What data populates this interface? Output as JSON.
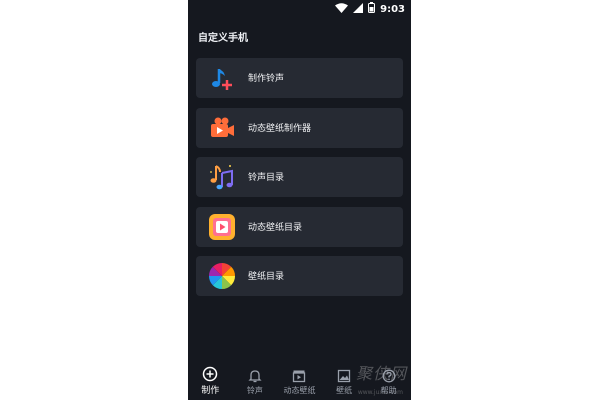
{
  "status_bar": {
    "time": "9:03"
  },
  "page_title": "自定义手机",
  "menu": [
    {
      "label": "制作铃声",
      "icon": "music-note-add-icon"
    },
    {
      "label": "动态壁纸制作器",
      "icon": "video-camera-icon"
    },
    {
      "label": "铃声目录",
      "icon": "music-notes-icon"
    },
    {
      "label": "动态壁纸目录",
      "icon": "play-video-icon"
    },
    {
      "label": "壁纸目录",
      "icon": "color-wheel-icon"
    }
  ],
  "tabs": [
    {
      "label": "制作",
      "icon": "plus-circle-icon",
      "active": true
    },
    {
      "label": "铃声",
      "icon": "bell-icon",
      "active": false
    },
    {
      "label": "动态壁纸",
      "icon": "clapper-icon",
      "active": false
    },
    {
      "label": "壁纸",
      "icon": "image-icon",
      "active": false
    },
    {
      "label": "帮助",
      "icon": "help-icon",
      "active": false
    }
  ],
  "watermark": {
    "text": "聚侠网",
    "sub": "www.juxia.com"
  },
  "colors": {
    "background": "#15181f",
    "card": "#262a33",
    "text": "#f2f3f5"
  }
}
